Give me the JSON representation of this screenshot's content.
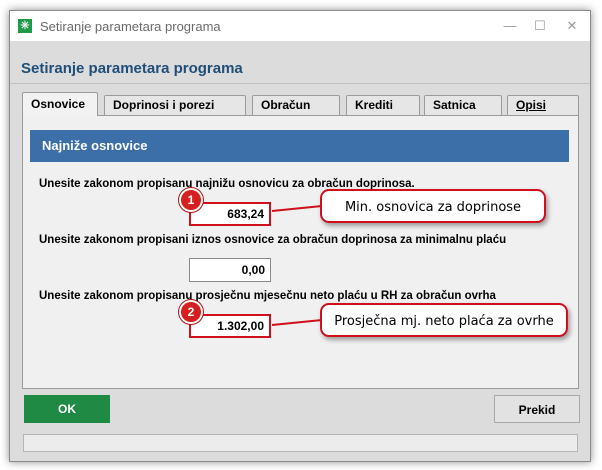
{
  "window": {
    "title": "Setiranje parametara programa"
  },
  "page": {
    "heading": "Setiranje parametara programa"
  },
  "tabs": [
    {
      "label": "Osnovice",
      "active": true
    },
    {
      "label": "Doprinosi i porezi"
    },
    {
      "label": "Obračun"
    },
    {
      "label": "Krediti"
    },
    {
      "label": "Satnica"
    },
    {
      "label": "Opisi"
    }
  ],
  "section": {
    "title": "Najniže osnovice"
  },
  "fields": [
    {
      "label": "Unesite zakonom propisanu najnižu osnovicu za obračun doprinosa.",
      "value": "683,24"
    },
    {
      "label": "Unesite zakonom propisani iznos osnovice za obračun doprinosa za minimalnu plaću",
      "value": "0,00"
    },
    {
      "label": "Unesite zakonom propisanu prosječnu mjesečnu neto plaću u RH za obračun ovrha",
      "value": "1.302,00"
    }
  ],
  "annotations": [
    {
      "badge": "1",
      "text": "Min. osnovica za doprinose"
    },
    {
      "badge": "2",
      "text": "Prosječna mj. neto plaća za ovrhe"
    }
  ],
  "buttons": {
    "ok": "OK",
    "cancel": "Prekid"
  },
  "colors": {
    "heading": "#1f4e79",
    "section_bar": "#3c6ea8",
    "ok_button": "#1e8a44",
    "annotation": "#d0101a"
  }
}
